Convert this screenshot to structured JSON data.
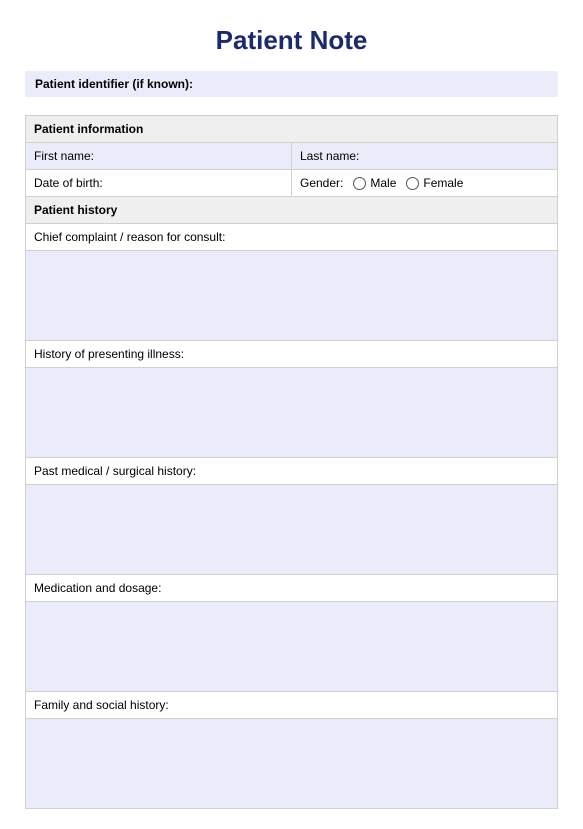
{
  "title": "Patient Note",
  "identifier_label": "Patient identifier (if known):",
  "section_info": "Patient information",
  "first_name_label": "First name:",
  "last_name_label": "Last name:",
  "dob_label": "Date of birth:",
  "gender_label": "Gender:",
  "gender_male": "Male",
  "gender_female": "Female",
  "section_history": "Patient history",
  "chief_complaint_label": "Chief complaint / reason for consult:",
  "hpi_label": "History of presenting illness:",
  "pmh_label": "Past medical / surgical history:",
  "medication_label": "Medication and dosage:",
  "family_social_label": "Family and social history:"
}
